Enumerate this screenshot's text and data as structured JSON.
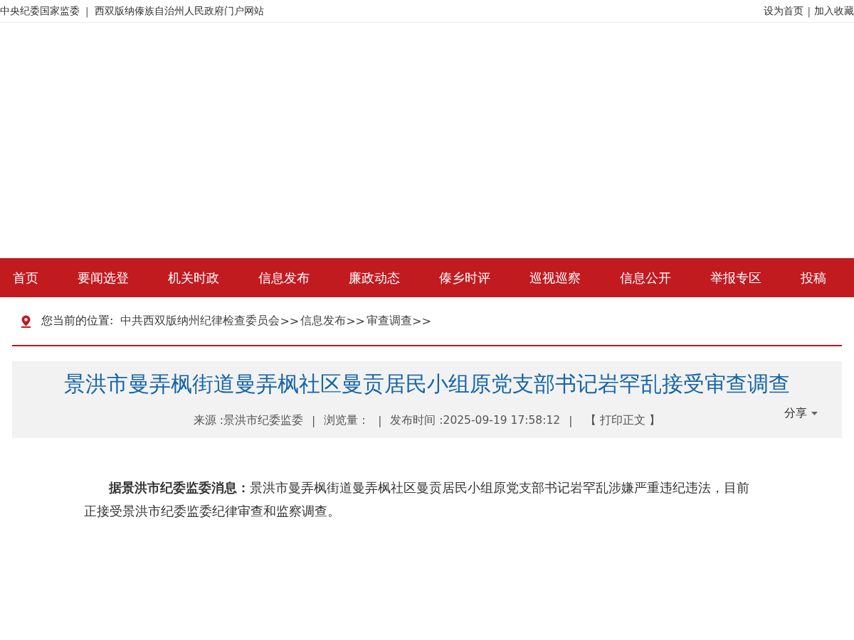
{
  "top_bar": {
    "left_links": [
      {
        "label": "中央纪委国家监委",
        "separator": "|"
      },
      {
        "label": "西双版纳傣族自治州人民政府门户网站"
      }
    ],
    "right_links": [
      {
        "label": "设为首页",
        "separator": "|"
      },
      {
        "label": "加入收藏"
      }
    ]
  },
  "nav": {
    "items": [
      "首页",
      "要闻选登",
      "机关时政",
      "信息发布",
      "廉政动态",
      "傣乡时评",
      "巡视巡察",
      "信息公开",
      "举报专区",
      "投稿"
    ]
  },
  "breadcrumb": {
    "label": "您当前的位置:",
    "crumbs": [
      {
        "label": "中共西双版纳州纪律检查委员会",
        "separator": ">>"
      },
      {
        "label": "信息发布",
        "separator": ">>"
      },
      {
        "label": "审查调查",
        "separator": ">>"
      }
    ]
  },
  "article": {
    "title": "景洪市曼弄枫街道曼弄枫社区曼贡居民小组原党支部书记岩罕乱接受审查调查",
    "meta": [
      {
        "kind": "text",
        "text": "来源 :景洪市纪委监委"
      },
      {
        "kind": "sep",
        "text": "|"
      },
      {
        "kind": "text",
        "text": "浏览量："
      },
      {
        "kind": "sep",
        "text": "|"
      },
      {
        "kind": "text",
        "text": "发布时间 :2025-09-19 17:58:12"
      },
      {
        "kind": "sep",
        "text": "|"
      },
      {
        "kind": "link",
        "text": "【 打印正文 】"
      }
    ],
    "share": "分享",
    "body": [
      "**据景洪市纪委监委消息：**景洪市曼弄枫街道曼弄枫社区曼贡居民小组原党支部书记岩罕乱涉嫌严重违纪违法，目前正接受景洪市纪委监委纪律审查和监察调查。"
    ]
  }
}
